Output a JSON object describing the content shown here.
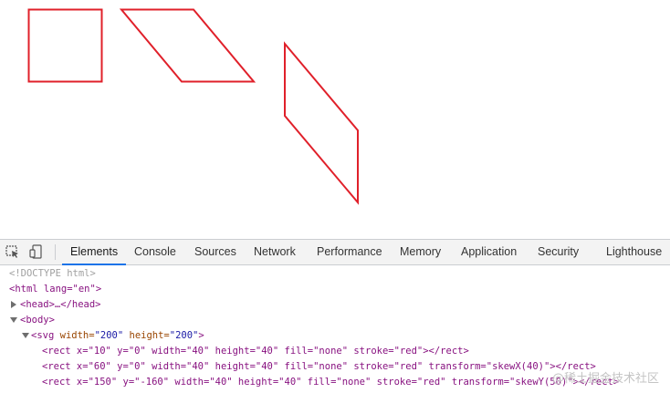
{
  "viewport": {
    "shapes": [
      {
        "name": "rect-1",
        "stroke": "#e0202a"
      },
      {
        "name": "rect-2-skewX",
        "stroke": "#e0202a"
      },
      {
        "name": "rect-3-skewY",
        "stroke": "#e0202a"
      }
    ]
  },
  "devtools": {
    "tabs": [
      "Elements",
      "Console",
      "Sources",
      "Network",
      "Performance",
      "Memory",
      "Application",
      "Security",
      "Lighthouse"
    ],
    "active_tab": "Elements",
    "accent": "#1a73e8"
  },
  "dom": {
    "doctype": "<!DOCTYPE html>",
    "html_open": "<html lang=\"en\">",
    "head": "<head>…</head>",
    "body_open": "<body>",
    "svg_line": {
      "open": "<svg",
      "width_attr": " width=",
      "width_val": "\"200\"",
      "height_attr": " height=",
      "height_val": "\"200\"",
      "close": ">"
    },
    "rect1": "<rect x=\"10\" y=\"0\" width=\"40\" height=\"40\" fill=\"none\" stroke=\"red\"></rect>",
    "rect2": "<rect x=\"60\" y=\"0\" width=\"40\" height=\"40\" fill=\"none\" stroke=\"red\" transform=\"skewX(40)\"></rect>",
    "rect3": "<rect x=\"150\" y=\"-160\" width=\"40\" height=\"40\" fill=\"none\" stroke=\"red\" transform=\"skewY(50)\"></rect>"
  },
  "watermark": "@稀土掘金技术社区"
}
